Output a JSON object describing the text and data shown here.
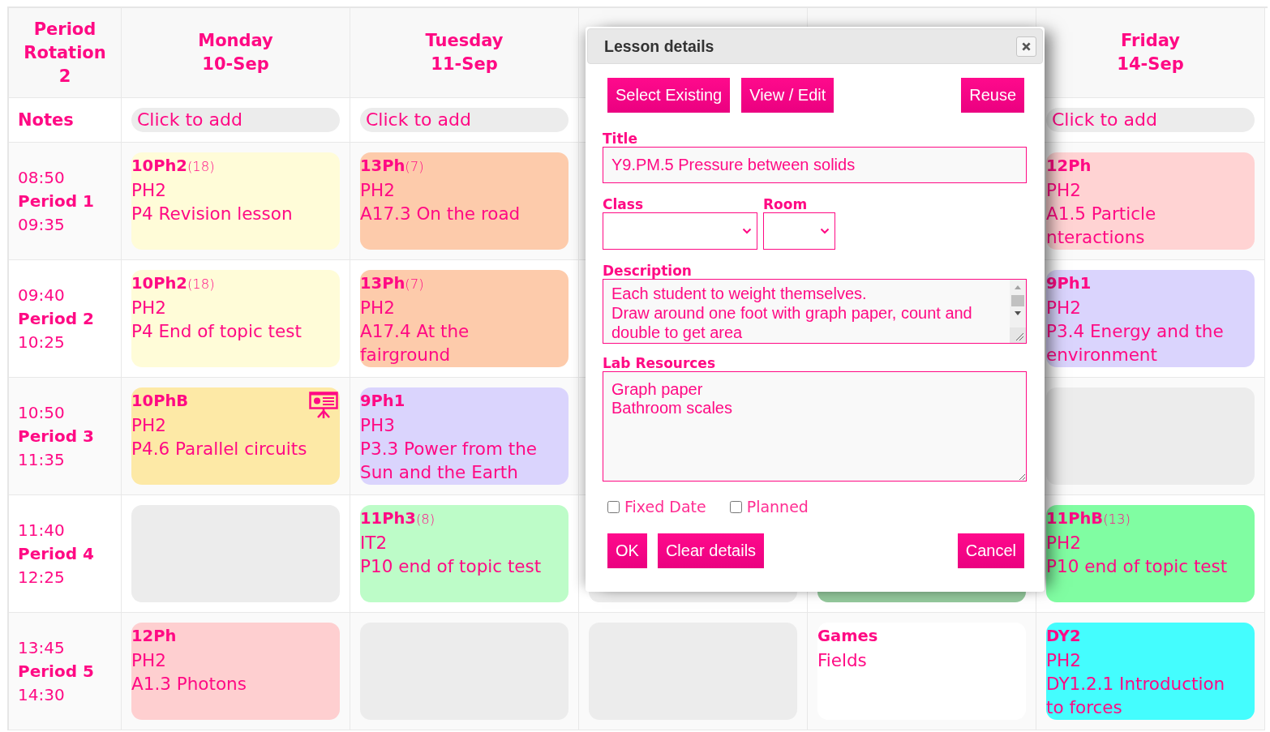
{
  "timetable": {
    "corner": "Period Rotation 2",
    "notes_label": "Notes",
    "columns": [
      {
        "kind": "day",
        "day": "Monday",
        "date": "10-Sep",
        "note": "Click to add"
      },
      {
        "kind": "day",
        "day": "Tuesday",
        "date": "11-Sep",
        "note": "Click to add"
      },
      {
        "kind": "hidden"
      },
      {
        "kind": "hidden"
      },
      {
        "kind": "day",
        "day": "Friday",
        "date": "14-Sep",
        "note": "Click to add"
      }
    ],
    "periods": [
      {
        "start": "08:50",
        "name": "Period 1",
        "end": "09:35",
        "slots": [
          {
            "kind": "lesson",
            "class": "10Ph2",
            "count": "(18)",
            "room": "PH2",
            "title": "P4 Revision lesson",
            "color": "#fffcd8",
            "presentation": false
          },
          {
            "kind": "lesson",
            "class": "13Ph",
            "count": "(7)",
            "room": "PH2",
            "title": "A17.3 On the road",
            "color": "#fdcbab",
            "presentation": false
          },
          {
            "kind": "hidden"
          },
          {
            "kind": "hidden"
          },
          {
            "kind": "lesson",
            "class": "12Ph",
            "room": "PH2",
            "title": "A1.5 Particle nteractions",
            "color": "#ffd3d3",
            "presentation": false
          }
        ]
      },
      {
        "start": "09:40",
        "name": "Period 2",
        "end": "10:25",
        "slots": [
          {
            "kind": "lesson",
            "class": "10Ph2",
            "count": "(18)",
            "room": "PH2",
            "title": "P4 End of topic test",
            "color": "#fffcd8",
            "presentation": false
          },
          {
            "kind": "lesson",
            "class": "13Ph",
            "count": "(7)",
            "room": "PH2",
            "title": "A17.4 At the fairground",
            "color": "#fdcbab",
            "presentation": false
          },
          {
            "kind": "hidden"
          },
          {
            "kind": "hidden"
          },
          {
            "kind": "lesson",
            "class": "9Ph1",
            "room": "PH2",
            "title": "P3.4 Energy and the environment",
            "color": "#dad4fd",
            "presentation": false
          }
        ]
      },
      {
        "start": "10:50",
        "name": "Period 3",
        "end": "11:35",
        "slots": [
          {
            "kind": "lesson",
            "class": "10PhB",
            "room": "PH2",
            "title": "P4.6 Parallel circuits",
            "color": "#fde9a6",
            "presentation": true
          },
          {
            "kind": "lesson",
            "class": "9Ph1",
            "room": "PH3",
            "title": "P3.3 Power from the Sun and the Earth",
            "color": "#dad4fd",
            "presentation": false
          },
          {
            "kind": "hidden"
          },
          {
            "kind": "hidden"
          },
          {
            "kind": "empty"
          }
        ]
      },
      {
        "start": "11:40",
        "name": "Period 4",
        "end": "12:25",
        "slots": [
          {
            "kind": "empty"
          },
          {
            "kind": "lesson",
            "class": "11Ph3",
            "count": "(8)",
            "room": "IT2",
            "title": "P10 end of topic test",
            "color": "#bdfcc8",
            "presentation": false
          },
          {
            "kind": "empty"
          },
          {
            "kind": "lesson",
            "color": "#93c89c"
          },
          {
            "kind": "lesson",
            "class": "11PhB",
            "count": "(13)",
            "room": "PH2",
            "title": "P10 end of topic test",
            "color": "#80fda2",
            "presentation": false
          }
        ]
      },
      {
        "start": "13:45",
        "name": "Period 5",
        "end": "14:30",
        "slots": [
          {
            "kind": "lesson",
            "class": "12Ph",
            "room": "PH2",
            "title": "A1.3 Photons",
            "color": "#fecfd0",
            "presentation": false
          },
          {
            "kind": "empty"
          },
          {
            "kind": "empty"
          },
          {
            "kind": "lesson",
            "class": "Games",
            "room": "Fields",
            "color": "#ffffff",
            "presentation": false
          },
          {
            "kind": "lesson",
            "class": "DY2",
            "room": "PH2",
            "title": "DY1.2.1 Introduction to forces",
            "color": "#44fdfe",
            "presentation": false
          }
        ]
      }
    ]
  },
  "lesson_dialog": {
    "title": "Lesson details",
    "top_buttons": [
      "Select Existing",
      "View / Edit",
      "Reuse"
    ],
    "title_field": {
      "label": "Title",
      "value": "Y9.PM.5 Pressure between solids"
    },
    "class_field": {
      "label": "Class"
    },
    "room_field": {
      "label": "Room"
    },
    "description": {
      "label": "Description",
      "lines": [
        "Each student to weight themselves.",
        "Draw around one foot with graph paper, count and",
        "double to get area"
      ]
    },
    "lab_resources": {
      "label": "Lab Resources",
      "lines": [
        "Graph paper",
        "Bathroom scales"
      ]
    },
    "options": [
      {
        "label": "Fixed Date",
        "checked": false
      },
      {
        "label": "Planned",
        "checked": false
      }
    ],
    "bottom_buttons": [
      "OK",
      "Clear details",
      "Cancel"
    ]
  }
}
